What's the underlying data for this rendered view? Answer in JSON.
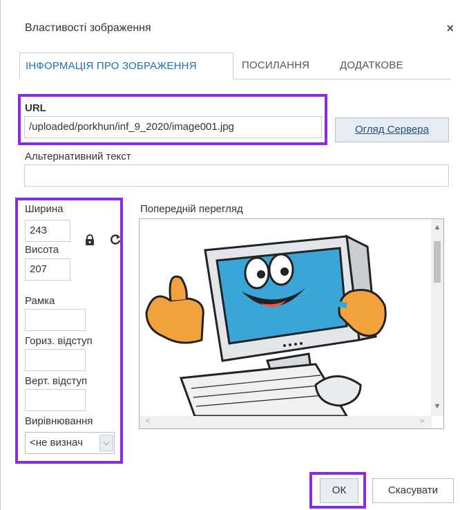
{
  "dialog": {
    "title": "Властивості зображення",
    "close_icon": "×"
  },
  "tabs": [
    {
      "label": "ІНФОРМАЦІЯ ПРО ЗОБРАЖЕННЯ",
      "active": true
    },
    {
      "label": "ПОСИЛАННЯ",
      "active": false
    },
    {
      "label": "ДОДАТКОВЕ",
      "active": false
    }
  ],
  "url": {
    "label": "URL",
    "value": "/uploaded/porkhun/inf_9_2020/image001.jpg",
    "browse_button": "Огляд Сервера"
  },
  "alt_text": {
    "label": "Альтернативний текст",
    "value": ""
  },
  "dimensions": {
    "width_label": "Ширина",
    "width_value": "243",
    "height_label": "Висота",
    "height_value": "207",
    "border_label": "Рамка",
    "border_value": "",
    "hspace_label": "Гориз. відступ",
    "hspace_value": "",
    "vspace_label": "Верт. відступ",
    "vspace_value": "",
    "align_label": "Вирівнювання",
    "align_value": "<не визнач"
  },
  "preview": {
    "label": "Попередній перегляд"
  },
  "icons": {
    "lock": "lock-icon",
    "reset": "reset-size-icon"
  },
  "footer": {
    "ok_label": "ОК",
    "cancel_label": "Скасувати"
  },
  "colors": {
    "highlight": "#8a2be2",
    "active_tab_text": "#1f6fb5"
  }
}
